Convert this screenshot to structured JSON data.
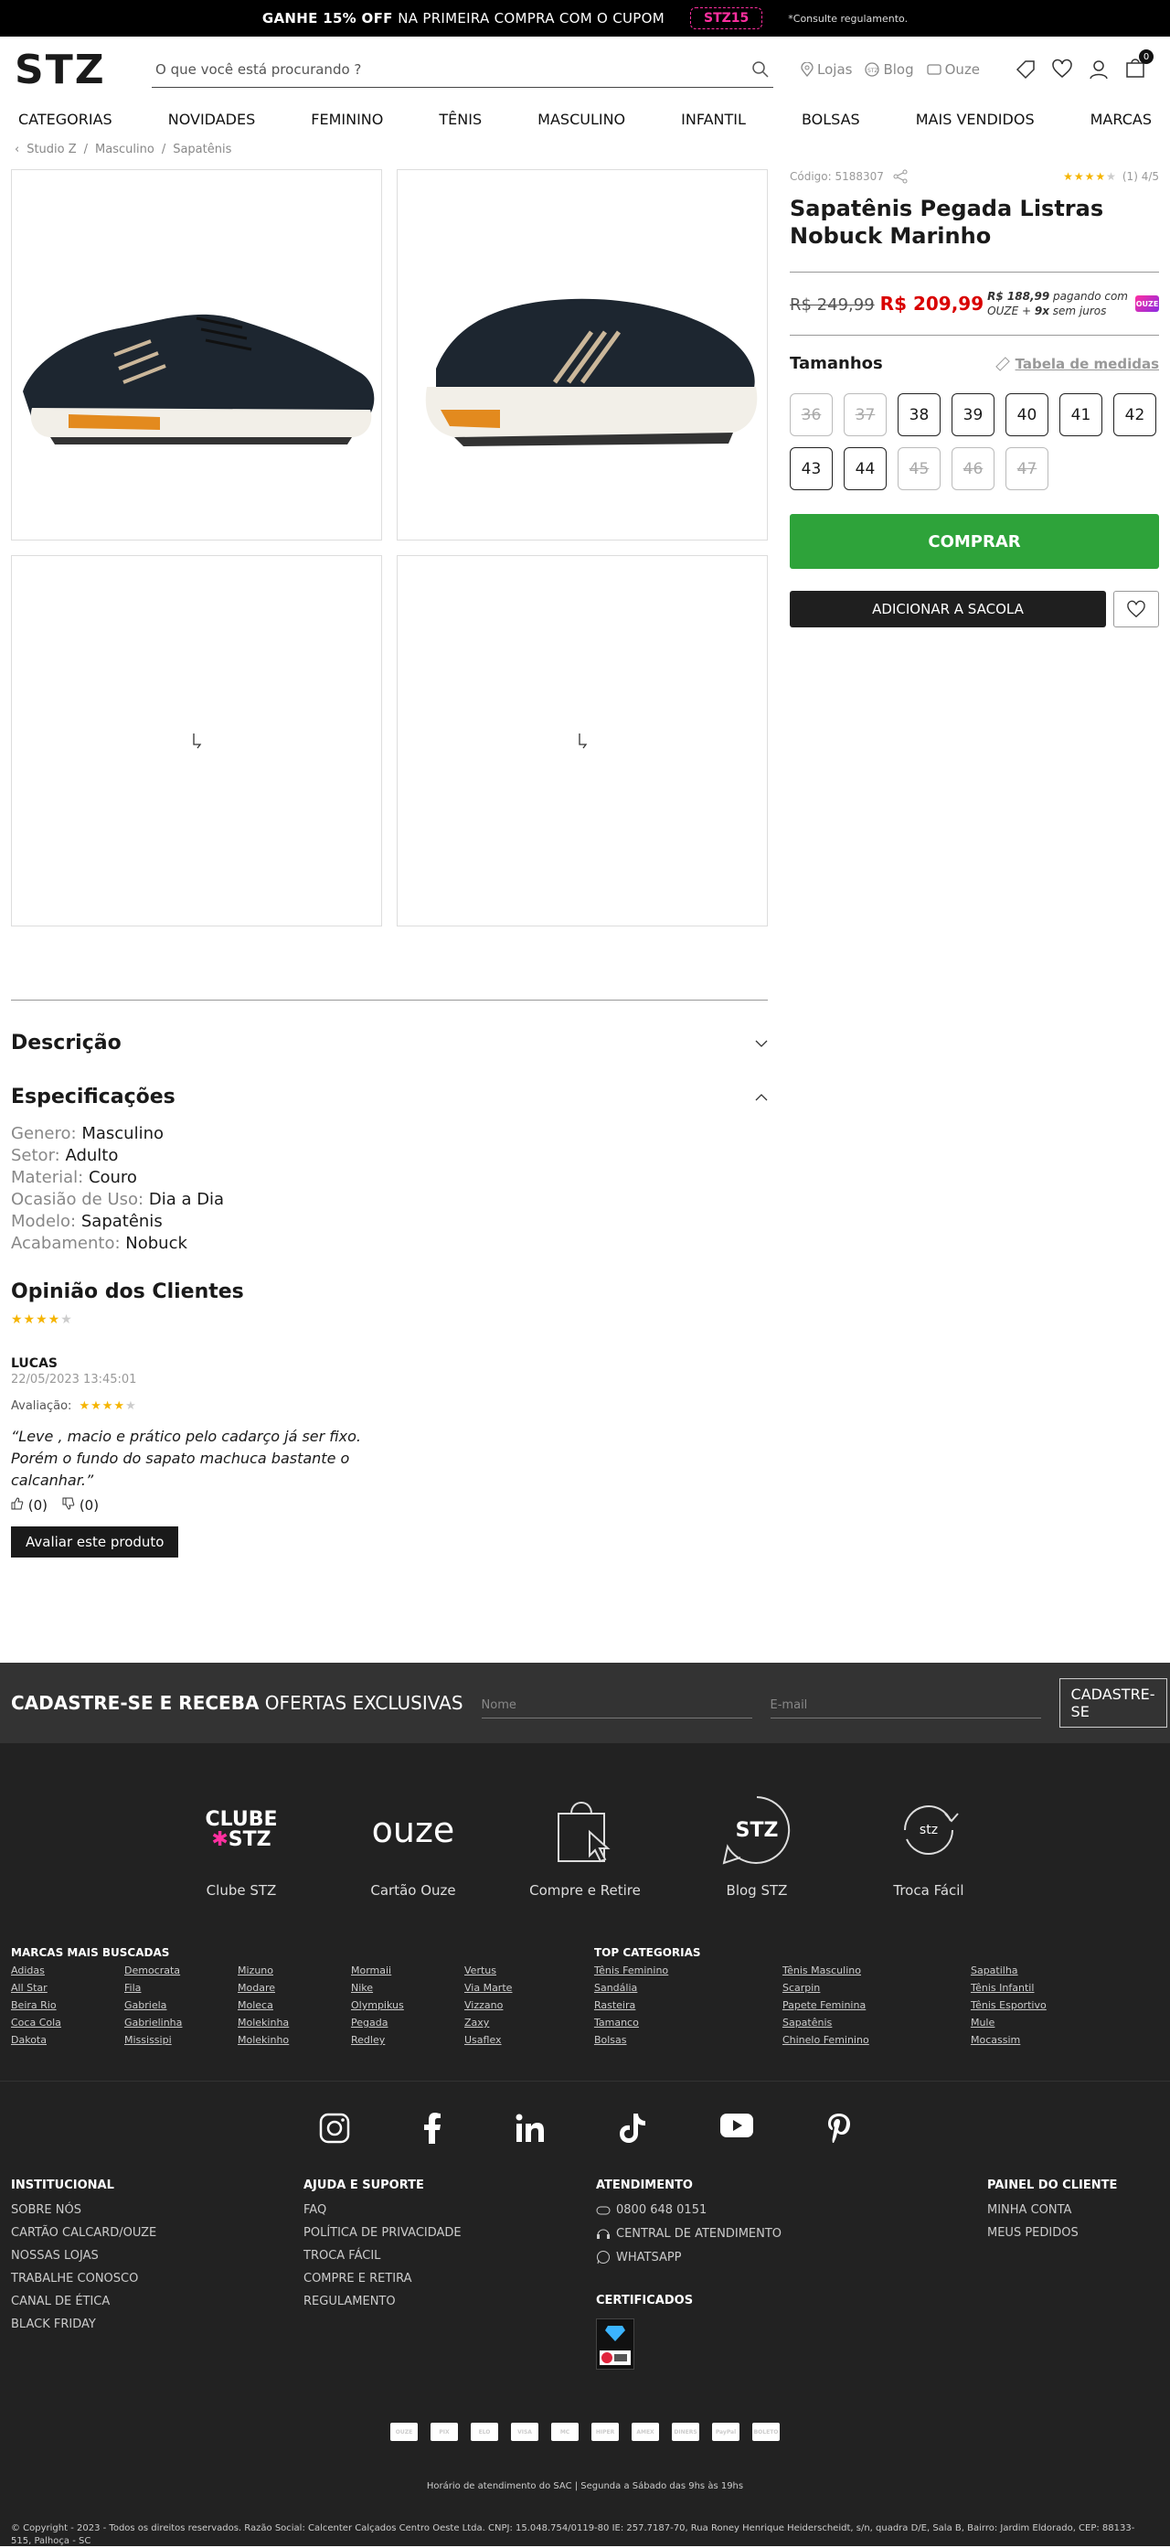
{
  "topbar": {
    "promo_bold": "GANHE 15% OFF",
    "promo_rest": "NA PRIMEIRA COMPRA COM O CUPOM",
    "coupon": "STZ15",
    "note": "*Consulte regulamento."
  },
  "header": {
    "logo": "STZ",
    "search_placeholder": "O que você está procurando ?",
    "links": [
      "Lojas",
      "Blog",
      "Ouze"
    ],
    "cart_count": "0"
  },
  "nav": [
    "CATEGORIAS",
    "NOVIDADES",
    "FEMININO",
    "TÊNIS",
    "MASCULINO",
    "INFANTIL",
    "BOLSAS",
    "MAIS VENDIDOS",
    "MARCAS"
  ],
  "breadcrumb": [
    "Studio Z",
    "Masculino",
    "Sapatênis"
  ],
  "product": {
    "code": "Código: 5188307",
    "rating": "(1) 4/5",
    "title": "Sapatênis Pegada Listras Nobuck Marinho",
    "old_price": "R$ 249,99",
    "price": "R$ 209,99",
    "ouze_price": "R$ 188,99",
    "ouze_text1": "pagando com",
    "ouze_text2": "OUZE +",
    "ouze_inst": "9x",
    "ouze_text3": "sem juros",
    "ouze_badge": "OUZE"
  },
  "sizes": {
    "title": "Tamanhos",
    "measure": "Tabela de medidas",
    "items": [
      {
        "n": "36",
        "ok": false
      },
      {
        "n": "37",
        "ok": false
      },
      {
        "n": "38",
        "ok": true
      },
      {
        "n": "39",
        "ok": true
      },
      {
        "n": "40",
        "ok": true
      },
      {
        "n": "41",
        "ok": true
      },
      {
        "n": "42",
        "ok": true
      },
      {
        "n": "43",
        "ok": true
      },
      {
        "n": "44",
        "ok": true
      },
      {
        "n": "45",
        "ok": false
      },
      {
        "n": "46",
        "ok": false
      },
      {
        "n": "47",
        "ok": false
      }
    ]
  },
  "actions": {
    "buy": "COMPRAR",
    "bag": "ADICIONAR A SACOLA"
  },
  "details": {
    "desc": "Descrição",
    "spec": "Especificações",
    "specs": [
      {
        "k": "Genero:",
        "v": "Masculino"
      },
      {
        "k": "Setor:",
        "v": "Adulto"
      },
      {
        "k": "Material:",
        "v": "Couro"
      },
      {
        "k": "Ocasião de Uso:",
        "v": "Dia a Dia"
      },
      {
        "k": "Modelo:",
        "v": "Sapatênis"
      },
      {
        "k": "Acabamento:",
        "v": "Nobuck"
      }
    ]
  },
  "reviews": {
    "title": "Opinião dos Clientes",
    "name": "LUCAS",
    "date": "22/05/2023 13:45:01",
    "label": "Avaliação:",
    "text": "“Leve , macio e prático pelo cadarço já ser fixo. Porém o fundo do sapato machuca bastante o calcanhar.”",
    "likes": "(0)",
    "dislikes": "(0)",
    "button": "Avaliar este produto",
    "stars": 4
  },
  "newsletter": {
    "title_bold": "CADASTRE-SE E RECEBA",
    "title_rest": "OFERTAS EXCLUSIVAS",
    "name": "Nome",
    "email": "E-mail",
    "button": "CADASTRE-SE"
  },
  "features": [
    {
      "label": "Clube STZ",
      "logo1": "CLUBE",
      "logo2": "STZ"
    },
    {
      "label": "Cartão Ouze",
      "logo1": "ouze"
    },
    {
      "label": "Compre e Retire"
    },
    {
      "label": "Blog STZ",
      "logo1": "STZ"
    },
    {
      "label": "Troca Fácil",
      "logo1": "stz"
    }
  ],
  "brands": {
    "title": "MARCAS MAIS BUSCADAS",
    "cols": [
      [
        "Adidas",
        "All Star",
        "Beira Rio",
        "Coca Cola",
        "Dakota"
      ],
      [
        "Democrata",
        "Fila",
        "Gabriela",
        "Gabrielinha",
        "Mississipi"
      ],
      [
        "Mizuno",
        "Modare",
        "Moleca",
        "Molekinha",
        "Molekinho"
      ],
      [
        "Mormaii",
        "Nike",
        "Olympikus",
        "Pegada",
        "Redley"
      ],
      [
        "Vertus",
        "Via Marte",
        "Vizzano",
        "Zaxy",
        "Usaflex"
      ]
    ]
  },
  "topcats": {
    "title": "TOP CATEGORIAS",
    "cols": [
      [
        "Tênis Feminino",
        "Sandália",
        "Rasteira",
        "Tamanco",
        "Bolsas"
      ],
      [
        "Tênis Masculino",
        "Scarpin",
        "Papete Feminina",
        "Sapatênis",
        "Chinelo Feminino"
      ],
      [
        "Sapatilha",
        "Tênis Infantil",
        "Tênis Esportivo",
        "Mule",
        "Mocassim"
      ]
    ]
  },
  "footer_links": {
    "inst": {
      "title": "INSTITUCIONAL",
      "items": [
        "SOBRE NÓS",
        "CARTÃO CALCARD/OUZE",
        "NOSSAS LOJAS",
        "TRABALHE CONOSCO",
        "CANAL DE ÉTICA",
        "BLACK FRIDAY"
      ]
    },
    "ajuda": {
      "title": "AJUDA E SUPORTE",
      "items": [
        "FAQ",
        "POLÍTICA DE PRIVACIDADE",
        "TROCA FÁCIL",
        "COMPRE E RETIRA",
        "REGULAMENTO"
      ]
    },
    "atend": {
      "title": "ATENDIMENTO",
      "items": [
        "0800 648 0151",
        "CENTRAL DE ATENDIMENTO",
        "WHATSAPP"
      ],
      "cert": "CERTIFICADOS"
    },
    "painel": {
      "title": "PAINEL DO CLIENTE",
      "items": [
        "MINHA CONTA",
        "MEUS PEDIDOS"
      ]
    }
  },
  "payments": [
    "OUZE",
    "PIX",
    "ELO",
    "VISA",
    "MC",
    "HIPER",
    "AMEX",
    "DINERS",
    "PayPal",
    "BOLETO"
  ],
  "sac": "Horário de atendimento do SAC | Segunda a Sábado das 9hs às 19hs",
  "copyright": "© Copyright - 2023 - Todos os direitos reservados. Razão Social: Calcenter Calçados Centro Oeste Ltda. CNPJ: 15.048.754/0119-80 IE: 257.7187-70, Rua Roney Henrique Heiderscheidt, s/n, quadra D/E, Sala B, Bairro: Jardim Eldorado, CEP: 88133-515, Palhoça - SC",
  "colors": {
    "accent_green": "#2ea33a",
    "price_red": "#d90000",
    "coupon_pink": "#ff2fa0",
    "footer_bg": "#222222"
  }
}
